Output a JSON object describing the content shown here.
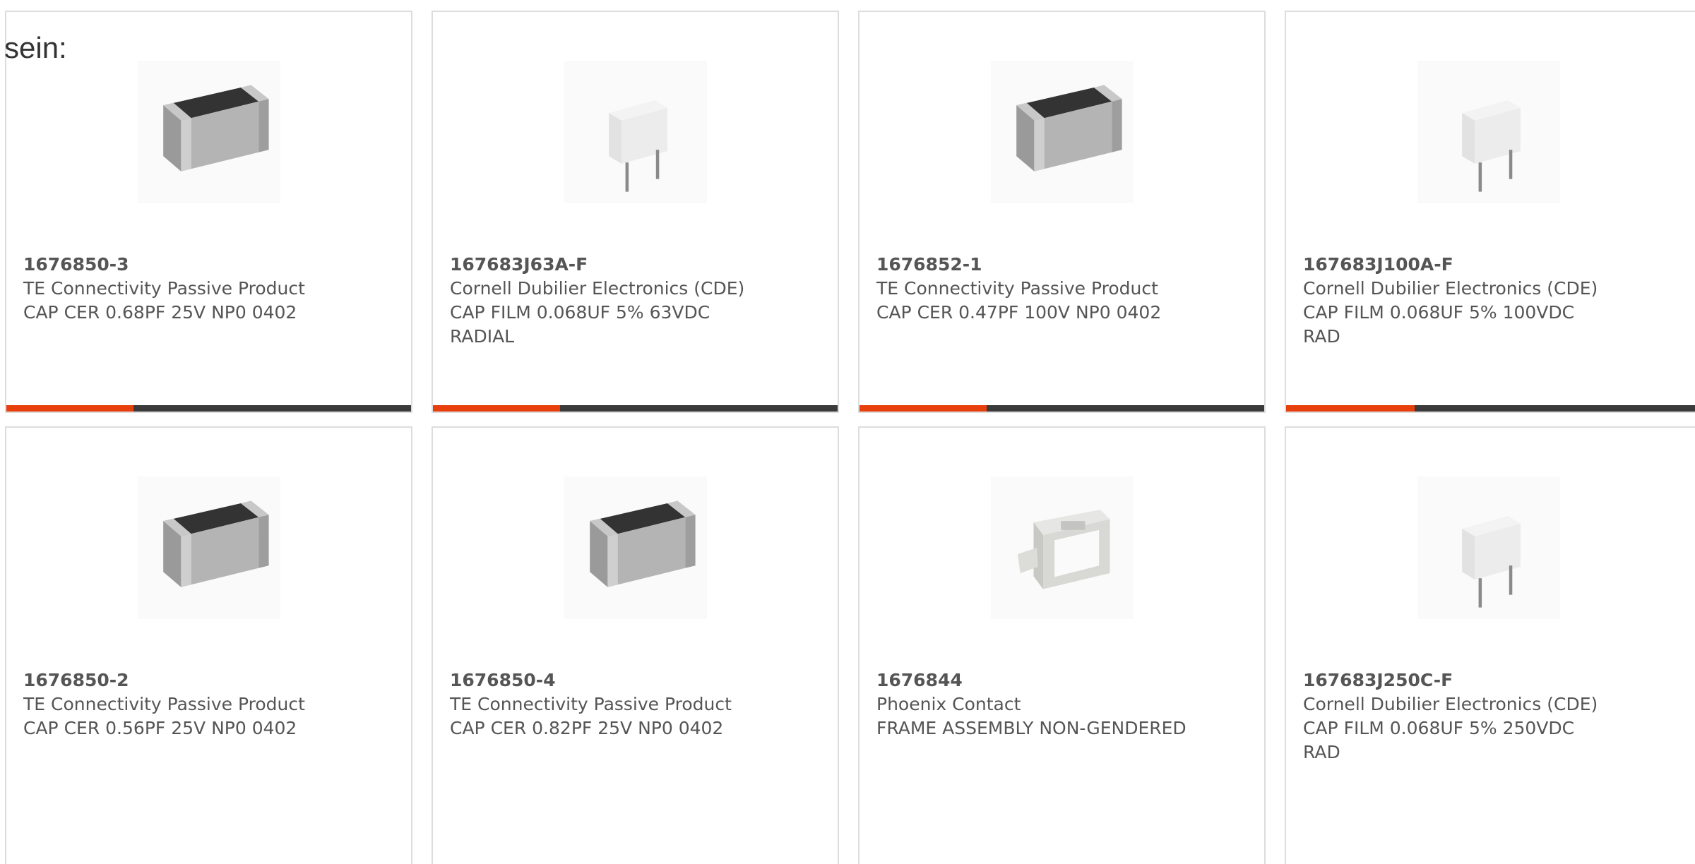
{
  "intro_text": "sein:",
  "colors": {
    "accent": "#e8400c",
    "bar": "#3a3a3a",
    "text": "#555555",
    "border": "#dddddd"
  },
  "products": [
    {
      "part": "1676850-3",
      "maker": "TE Connectivity Passive Product",
      "description": "CAP CER 0.68PF 25V NP0 0402",
      "image_icon": "chip-capacitor-icon"
    },
    {
      "part": "167683J63A-F",
      "maker": "Cornell Dubilier Electronics (CDE)",
      "description": "CAP FILM 0.068UF 5% 63VDC RADIAL",
      "image_icon": "film-capacitor-icon"
    },
    {
      "part": "1676852-1",
      "maker": "TE Connectivity Passive Product",
      "description": "CAP CER 0.47PF 100V NP0 0402",
      "image_icon": "chip-capacitor-icon"
    },
    {
      "part": "167683J100A-F",
      "maker": "Cornell Dubilier Electronics (CDE)",
      "description": "CAP FILM 0.068UF 5% 100VDC RAD",
      "image_icon": "film-capacitor-icon"
    },
    {
      "part": "1676850-2",
      "maker": "TE Connectivity Passive Product",
      "description": "CAP CER 0.56PF 25V NP0 0402",
      "image_icon": "chip-capacitor-icon"
    },
    {
      "part": "1676850-4",
      "maker": "TE Connectivity Passive Product",
      "description": "CAP CER 0.82PF 25V NP0 0402",
      "image_icon": "chip-capacitor-icon"
    },
    {
      "part": "1676844",
      "maker": "Phoenix Contact",
      "description": "FRAME ASSEMBLY NON-GENDERED",
      "image_icon": "frame-assembly-icon"
    },
    {
      "part": "167683J250C-F",
      "maker": "Cornell Dubilier Electronics (CDE)",
      "description": "CAP FILM 0.068UF 5% 250VDC RAD",
      "image_icon": "film-capacitor-icon"
    }
  ]
}
